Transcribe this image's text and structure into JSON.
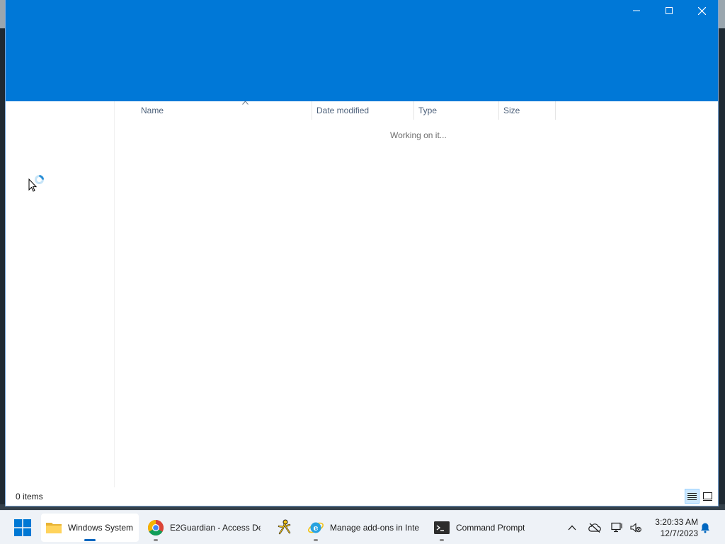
{
  "window": {
    "title": "",
    "accent_color": "#0078d7"
  },
  "columns": {
    "name": "Name",
    "date_modified": "Date modified",
    "type": "Type",
    "size": "Size",
    "sorted_by": "Name"
  },
  "content": {
    "working_text": "Working on it..."
  },
  "statusbar": {
    "items_count": "0 items"
  },
  "taskbar": {
    "apps": [
      {
        "label": "Windows System",
        "icon": "folder-icon",
        "active": true
      },
      {
        "label": "E2Guardian - Access De",
        "icon": "chrome-icon",
        "active": false
      },
      {
        "label": "",
        "icon": "aim-icon",
        "active": false
      },
      {
        "label": "Manage add-ons in Inte",
        "icon": "internet-explorer-icon",
        "active": false
      },
      {
        "label": "Command Prompt",
        "icon": "command-prompt-icon",
        "active": false
      }
    ],
    "clock": {
      "time": "3:20:33 AM",
      "date": "12/7/2023"
    }
  }
}
